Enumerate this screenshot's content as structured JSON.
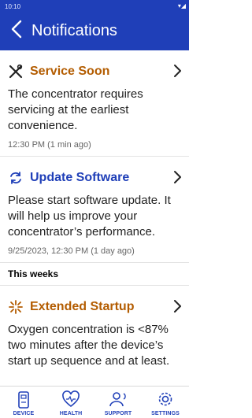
{
  "status": {
    "time": "10:10"
  },
  "header": {
    "title": "Notifications"
  },
  "notifications": [
    {
      "title": "Service Soon",
      "title_color": "#b35c00",
      "icon": "wrench-screwdriver-icon",
      "body": [
        "The concentrator requires",
        "servicing at the earliest",
        "convenience."
      ],
      "time": "12:30 PM (1 min ago)"
    },
    {
      "title": "Update Software",
      "title_color": "#1f3fb8",
      "icon": "update-arrows-icon",
      "body": [
        "Please start software update. It",
        "will help us improve your",
        "concentrator’s performance."
      ],
      "time": "9/25/2023, 12:30 PM (1 day ago)"
    }
  ],
  "section": {
    "label": "This weeks"
  },
  "weekly": [
    {
      "title": "Extended Startup",
      "title_color": "#b35c00",
      "icon": "startup-burst-icon",
      "body": [
        "Oxygen concentration is <87%",
        "two minutes after the device’s",
        "start up sequence and at least."
      ]
    }
  ],
  "tabs": [
    {
      "label": "DEVICE",
      "icon": "device-icon"
    },
    {
      "label": "HEALTH",
      "icon": "heart-icon"
    },
    {
      "label": "SUPPORT",
      "icon": "support-icon"
    },
    {
      "label": "SETTINGS",
      "icon": "gear-icon"
    }
  ],
  "colors": {
    "primary": "#1f3fb8",
    "warning": "#b35c00"
  }
}
